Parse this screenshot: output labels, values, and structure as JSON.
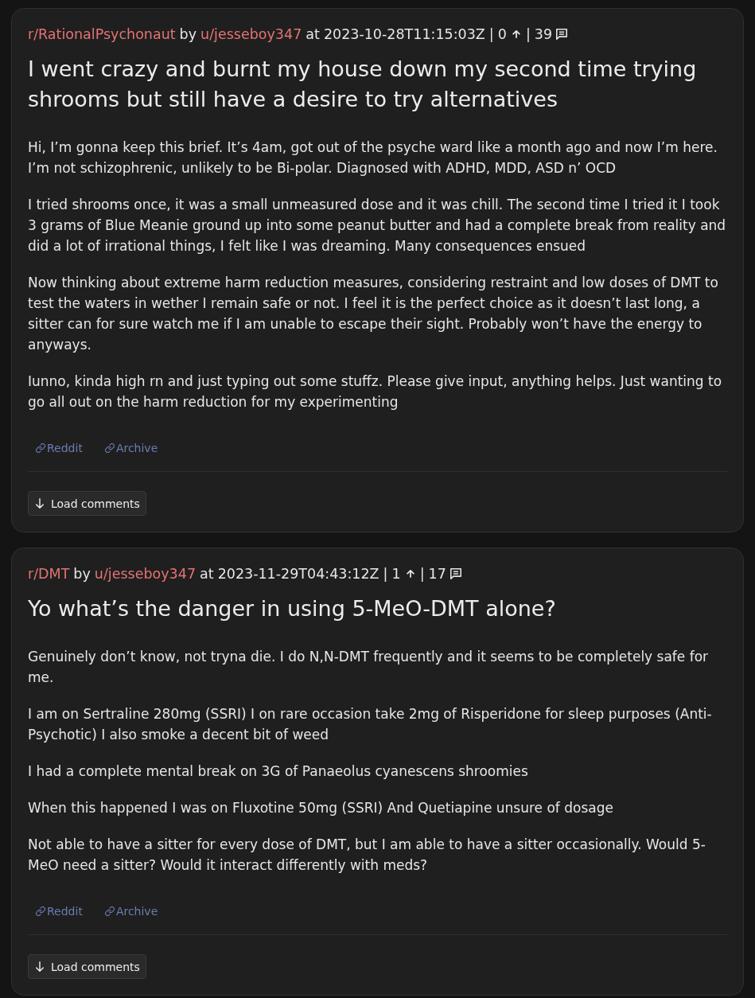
{
  "posts": [
    {
      "meta": {
        "subreddit": "r/RationalPsychonaut",
        "by_label": "by",
        "author": "u/jesseboy347",
        "at_label": "at",
        "timestamp": "2023-10-28T11:15:03Z",
        "separators": [
          "|",
          "|"
        ],
        "score": "0",
        "comments": "39"
      },
      "title": "I went crazy and burnt my house down my second time trying shrooms but still have a desire to try alternatives",
      "paragraphs": [
        "Hi, I’m gonna keep this brief. It’s 4am, got out of the psyche ward like a month ago and now I’m here. I’m not schizophrenic, unlikely to be Bi-polar. Diagnosed with ADHD, MDD, ASD n’ OCD",
        "I tried shrooms once, it was a small unmeasured dose and it was chill. The second time I tried it I took 3 grams of Blue Meanie ground up into some peanut butter and had a complete break from reality and did a lot of irrational things, I felt like I was dreaming. Many consequences ensued",
        "Now thinking about extreme harm reduction measures, considering restraint and low doses of DMT to test the waters in wether I remain safe or not. I feel it is the perfect choice as it doesn’t last long, a sitter can for sure watch me if I am unable to escape their sight. Probably won’t have the energy to anyways.",
        "Iunno, kinda high rn and just typing out some stuffz. Please give input, anything helps. Just wanting to go all out on the harm reduction for my experimenting"
      ],
      "links": [
        "Reddit",
        "Archive"
      ],
      "load_button": "Load comments"
    },
    {
      "meta": {
        "subreddit": "r/DMT",
        "by_label": "by",
        "author": "u/jesseboy347",
        "at_label": "at",
        "timestamp": "2023-11-29T04:43:12Z",
        "separators": [
          "|",
          "|"
        ],
        "score": "1",
        "comments": "17"
      },
      "title": "Yo what’s the danger in using 5-MeO-DMT alone?",
      "paragraphs": [
        "Genuinely don’t know, not tryna die. I do N,N-DMT frequently and it seems to be completely safe for me.",
        "I am on Sertraline 280mg (SSRI) I on rare occasion take 2mg of Risperidone for sleep purposes (Anti-Psychotic) I also smoke a decent bit of weed",
        "I had a complete mental break on 3G of Panaeolus cyanescens shroomies",
        "When this happened I was on Fluxotine 50mg (SSRI) And Quetiapine unsure of dosage",
        "Not able to have a sitter for every dose of DMT, but I am able to have a sitter occasionally. Would 5-MeO need a sitter? Would it interact differently with meds?"
      ],
      "links": [
        "Reddit",
        "Archive"
      ],
      "load_button": "Load comments"
    }
  ]
}
